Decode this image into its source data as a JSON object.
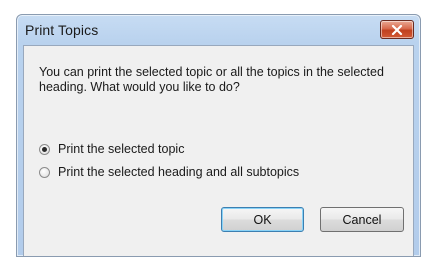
{
  "window": {
    "title": "Print Topics",
    "close_icon": "close-icon"
  },
  "dialog": {
    "message": "You can print the selected topic or all the topics in the selected heading. What would you like to do?",
    "options": [
      {
        "label": "Print the selected topic",
        "selected": true
      },
      {
        "label": "Print the selected heading and all subtopics",
        "selected": false
      }
    ],
    "buttons": {
      "ok_label": "OK",
      "cancel_label": "Cancel"
    }
  },
  "colors": {
    "title_bar": "#b9d2ee",
    "close_button": "#c0401f",
    "client_background": "#f0f0f0",
    "default_button_border": "#3c7fb1"
  }
}
